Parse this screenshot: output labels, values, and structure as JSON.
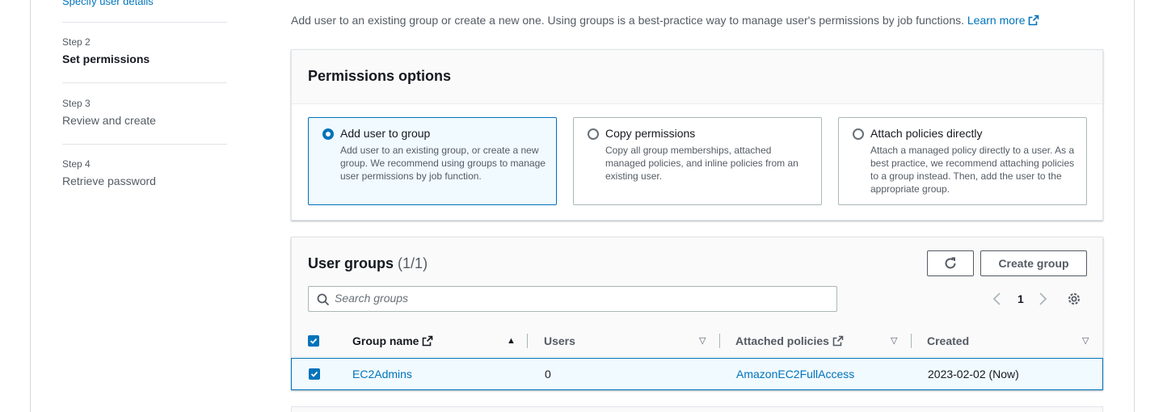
{
  "steps": {
    "top_link": "Specify user details",
    "items": [
      {
        "num": "Step 2",
        "name": "Set permissions"
      },
      {
        "num": "Step 3",
        "name": "Review and create"
      },
      {
        "num": "Step 4",
        "name": "Retrieve password"
      }
    ]
  },
  "intro": {
    "text": "Add user to an existing group or create a new one. Using groups is a best-practice way to manage user's permissions by job functions.",
    "learn_more": "Learn more"
  },
  "permissions": {
    "title": "Permissions options",
    "options": [
      {
        "title": "Add user to group",
        "desc": "Add user to an existing group, or create a new group. We recommend using groups to manage user permissions by job function.",
        "selected": true
      },
      {
        "title": "Copy permissions",
        "desc": "Copy all group memberships, attached managed policies, and inline policies from an existing user.",
        "selected": false
      },
      {
        "title": "Attach policies directly",
        "desc": "Attach a managed policy directly to a user. As a best practice, we recommend attaching policies to a group instead. Then, add the user to the appropriate group.",
        "selected": false
      }
    ]
  },
  "groups": {
    "title": "User groups",
    "count": "(1/1)",
    "create_label": "Create group",
    "search_placeholder": "Search groups",
    "page": "1",
    "columns": {
      "group_name": "Group name",
      "users": "Users",
      "policies": "Attached policies",
      "created": "Created"
    },
    "rows": [
      {
        "group_name": "EC2Admins",
        "users": "0",
        "policies": "AmazonEC2FullAccess",
        "created": "2023-02-02 (Now)",
        "selected": true
      }
    ]
  },
  "colors": {
    "accent": "#0073bb",
    "text": "#16191f",
    "muted": "#545b64",
    "selected_bg": "#f1faff"
  },
  "icons": [
    "external-link-icon",
    "search-icon",
    "refresh-icon",
    "chevron-left-icon",
    "chevron-right-icon",
    "settings-gear-icon",
    "sort-icon",
    "checkbox-checked-icon"
  ]
}
